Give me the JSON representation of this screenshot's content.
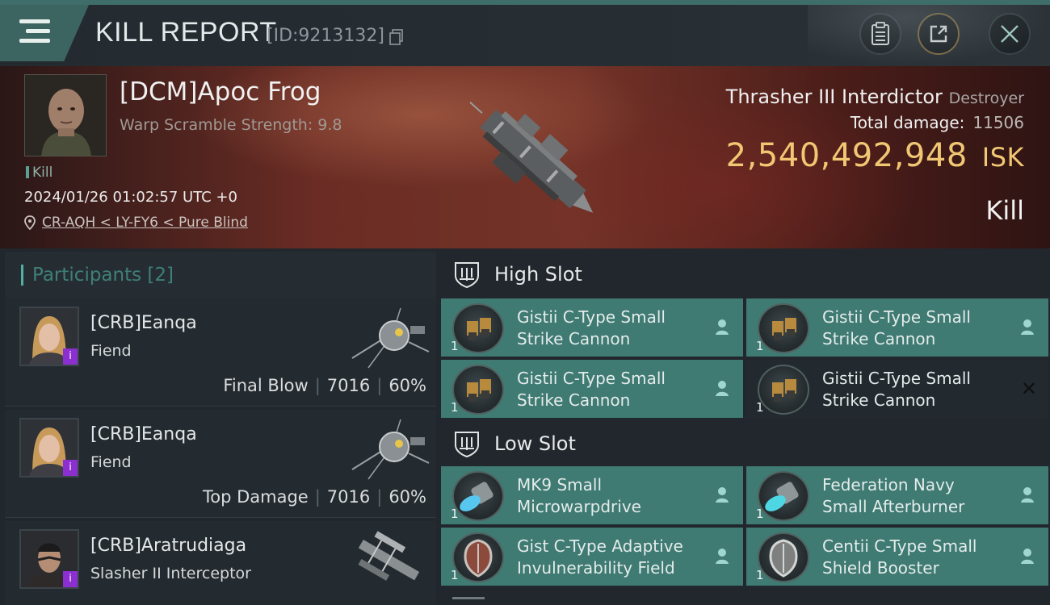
{
  "header": {
    "title": "KILL REPORT",
    "report_id": "[ID:9213132]",
    "icons": [
      "menu-icon",
      "copy-icon",
      "clipboard-icon",
      "share-icon",
      "close-icon"
    ]
  },
  "victim": {
    "pilot": "[DCM]Apoc Frog",
    "warp_scramble": "Warp Scramble Strength: 9.8",
    "tag": "Kill",
    "datetime": "2024/01/26 01:02:57 UTC +0",
    "location": "CR-AQH < LY-FY6 < Pure Blind",
    "ship": "Thrasher III Interdictor",
    "ship_class": "Destroyer",
    "total_damage_label": "Total damage:",
    "total_damage": "11506",
    "isk_value": "2,540,492,948",
    "isk_unit": "ISK",
    "result": "Kill"
  },
  "participants": {
    "title": "Participants [2]",
    "rows": [
      {
        "name": "[CRB]Eanqa",
        "ship": "Fiend",
        "role": "Final Blow",
        "damage": "7016",
        "percent": "60%",
        "badge": "i"
      },
      {
        "name": "[CRB]Eanqa",
        "ship": "Fiend",
        "role": "Top Damage",
        "damage": "7016",
        "percent": "60%",
        "badge": "i"
      },
      {
        "name": "[CRB]Aratrudiaga",
        "ship": "Slasher II Interceptor",
        "badge": "i"
      }
    ]
  },
  "slots": {
    "high": {
      "label": "High Slot",
      "modules": [
        {
          "line1": "Gistii C-Type Small",
          "line2": "Strike Cannon",
          "qty": "1"
        },
        {
          "line1": "Gistii C-Type Small",
          "line2": "Strike Cannon",
          "qty": "1"
        },
        {
          "line1": "Gistii C-Type Small",
          "line2": "Strike Cannon",
          "qty": "1"
        },
        {
          "line1": "Gistii C-Type Small",
          "line2": "Strike Cannon",
          "qty": "1"
        }
      ]
    },
    "low": {
      "label": "Low Slot",
      "modules": [
        {
          "line1": "MK9 Small",
          "line2": "Microwarpdrive",
          "qty": "1"
        },
        {
          "line1": "Federation Navy",
          "line2": "Small Afterburner",
          "qty": "1"
        },
        {
          "line1": "Gist C-Type Adaptive",
          "line2": "Invulnerability Field",
          "qty": "1"
        },
        {
          "line1": "Centii C-Type Small",
          "line2": "Shield Booster",
          "qty": "1"
        }
      ]
    },
    "close_mark": "✕"
  },
  "colors": {
    "accent_teal": "#3f7a73",
    "isk_gold": "#f1c774",
    "badge_purple": "#8c2fd0"
  }
}
